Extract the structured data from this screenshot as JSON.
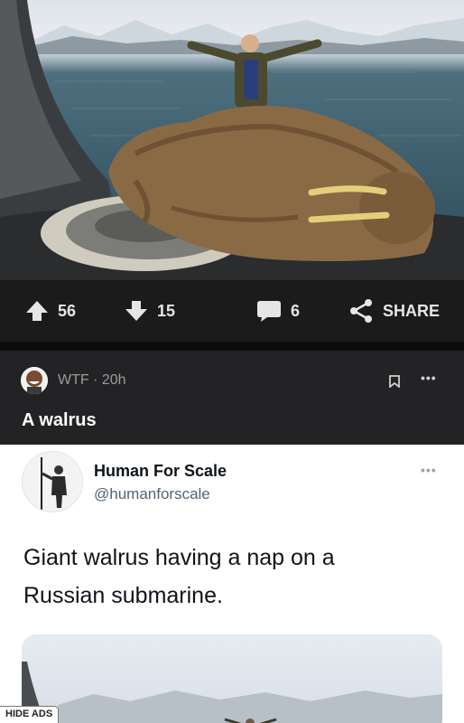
{
  "post": {
    "votes": {
      "up_count": "56",
      "down_count": "15",
      "comment_count": "6",
      "share_label": "SHARE"
    },
    "community": "WTF",
    "age": "20h",
    "meta_separator": " · ",
    "title": "A walrus"
  },
  "tweet": {
    "name": "Human For Scale",
    "handle": "@humanforscale",
    "text": "Giant walrus having a nap on a Russian submarine."
  },
  "ads": {
    "hide_label": "HIDE ADS"
  },
  "icons": {
    "upvote": "arrow-up-icon",
    "downvote": "arrow-down-icon",
    "comment": "speech-bubble-icon",
    "share": "share-icon",
    "bookmark": "bookmark-icon",
    "more": "more-dots-icon"
  },
  "colors": {
    "bar_bg": "#1b1b1b",
    "post_bg": "#232325",
    "text_light": "#e6e6e6",
    "meta_gray": "#9b9b9b"
  }
}
